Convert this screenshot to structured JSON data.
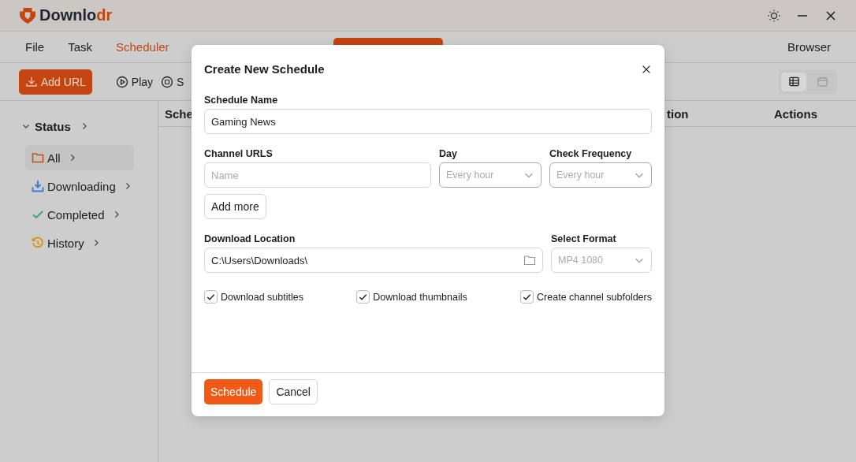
{
  "app": {
    "name": "Downlo",
    "name_accent": "dr"
  },
  "menu": [
    {
      "label": "File",
      "selected": false
    },
    {
      "label": "Task",
      "selected": false
    },
    {
      "label": "Scheduler",
      "selected": true
    }
  ],
  "menu_right": "Browser",
  "toolbar": {
    "add_url": "Add URL",
    "play": "Play",
    "stop": "S",
    "views": [
      {
        "kind": "table",
        "selected": true
      },
      {
        "kind": "calendar",
        "selected": false
      }
    ]
  },
  "sidebar": {
    "title": "Status",
    "expanded": true,
    "items": [
      {
        "kind": "folder",
        "label": "All",
        "selected": true,
        "color": "#c4501f"
      },
      {
        "kind": "download",
        "label": "Downloading",
        "selected": false,
        "color": "#3f7fd0"
      },
      {
        "kind": "check",
        "label": "Completed",
        "selected": false,
        "color": "#3aa36a"
      },
      {
        "kind": "history",
        "label": "History",
        "selected": false,
        "color": "#d4930f"
      }
    ]
  },
  "table": {
    "columns": [
      "Sche",
      "tion",
      "Actions"
    ]
  },
  "dialog": {
    "title": "Create New Schedule",
    "schedule_name": {
      "label": "Schedule Name",
      "value": "Gaming News"
    },
    "channel_urls": {
      "label": "Channel URLS",
      "placeholder": "Name"
    },
    "day": {
      "label": "Day",
      "placeholder": "Every hour"
    },
    "frequency": {
      "label": "Check Frequency",
      "placeholder": "Every hour"
    },
    "add_more": "Add more",
    "location": {
      "label": "Download Location",
      "value": "C:\\Users\\Downloads\\"
    },
    "format": {
      "label": "Select Format",
      "placeholder": "MP4 1080"
    },
    "options": [
      {
        "label": "Download subtitles",
        "checked": true
      },
      {
        "label": "Download thumbnails",
        "checked": true
      },
      {
        "label": "Create channel subfolders",
        "checked": true
      }
    ],
    "primary": "Schedule",
    "cancel": "Cancel"
  }
}
